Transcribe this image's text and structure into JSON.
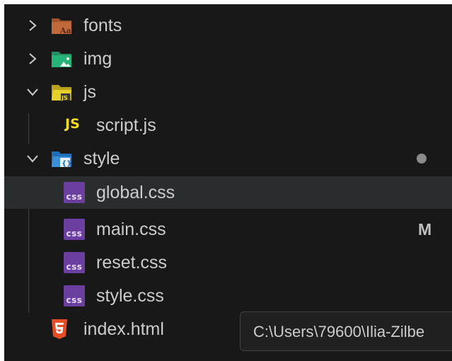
{
  "explorer": {
    "items": [
      {
        "label": "fonts",
        "type": "folder",
        "expanded": false,
        "icon": "folder-fonts-icon"
      },
      {
        "label": "img",
        "type": "folder",
        "expanded": false,
        "icon": "folder-images-icon"
      },
      {
        "label": "js",
        "type": "folder",
        "expanded": true,
        "icon": "folder-js-icon"
      },
      {
        "label": "script.js",
        "type": "file",
        "icon": "js-file-icon",
        "icon_text": "JS"
      },
      {
        "label": "style",
        "type": "folder",
        "expanded": true,
        "icon": "folder-css-icon",
        "status": "modified-dot"
      },
      {
        "label": "global.css",
        "type": "file",
        "icon": "css-file-icon",
        "icon_text": "css",
        "hovered": true
      },
      {
        "label": "main.css",
        "type": "file",
        "icon": "css-file-icon",
        "icon_text": "css",
        "badge": "M"
      },
      {
        "label": "reset.css",
        "type": "file",
        "icon": "css-file-icon",
        "icon_text": "css"
      },
      {
        "label": "style.css",
        "type": "file",
        "icon": "css-file-icon",
        "icon_text": "css"
      },
      {
        "label": "index.html",
        "type": "file",
        "icon": "html-file-icon"
      }
    ],
    "tooltip": "C:\\Users\\79600\\Ilia-Zilbe"
  },
  "colors": {
    "background": "#181818",
    "hover_row": "#2a2d2e",
    "text": "#cccccc",
    "js_yellow": "#f5de19",
    "css_purple": "#6b3fa0",
    "html_orange": "#e44d26"
  }
}
